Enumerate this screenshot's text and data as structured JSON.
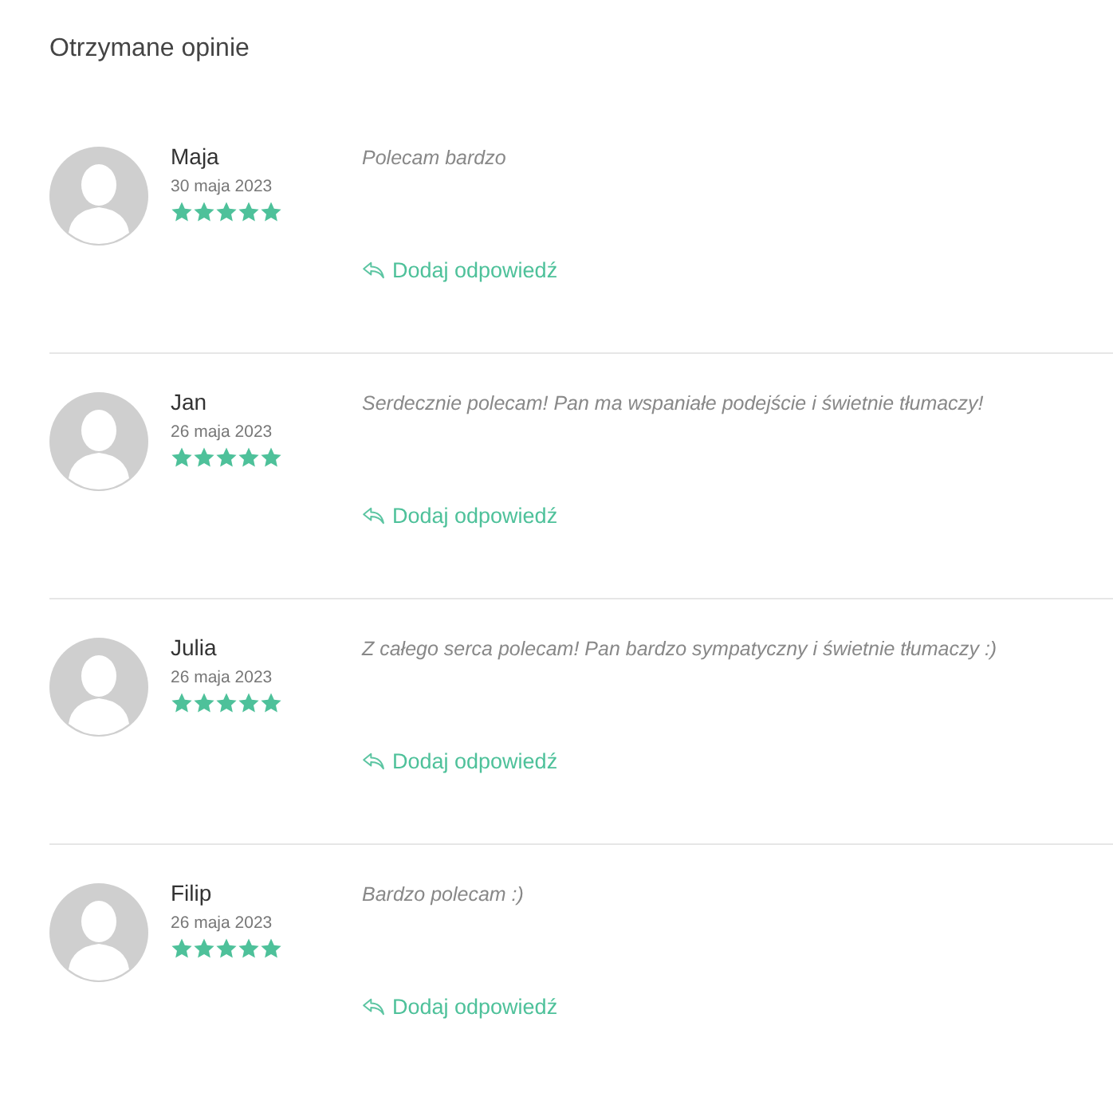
{
  "title": "Otrzymane opinie",
  "reviews": [
    {
      "name": "Maja",
      "date": "30 maja 2023",
      "stars": 5,
      "comment": "Polecam bardzo",
      "reply": "Dodaj odpowiedź"
    },
    {
      "name": "Jan",
      "date": "26 maja 2023",
      "stars": 5,
      "comment": "Serdecznie polecam! Pan ma wspaniałe podejście i świetnie tłumaczy!",
      "reply": "Dodaj odpowiedź"
    },
    {
      "name": "Julia",
      "date": "26 maja 2023",
      "stars": 5,
      "comment": "Z całego serca polecam! Pan bardzo sympatyczny i świetnie tłumaczy :)",
      "reply": "Dodaj odpowiedź"
    },
    {
      "name": "Filip",
      "date": "26 maja 2023",
      "stars": 5,
      "comment": "Bardzo polecam :)",
      "reply": "Dodaj odpowiedź"
    }
  ]
}
